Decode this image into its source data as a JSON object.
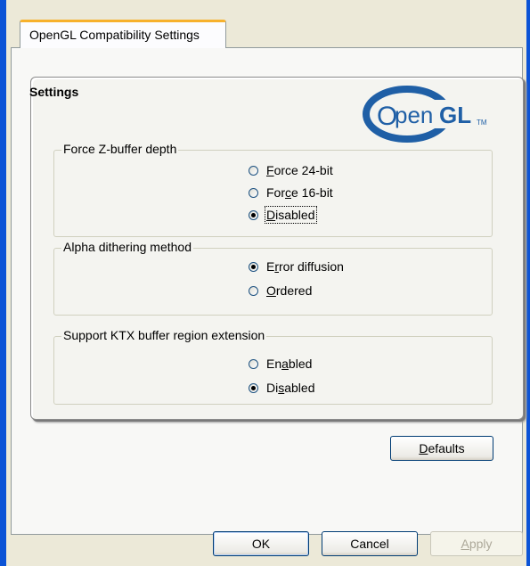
{
  "tab": {
    "label": "OpenGL Compatibility Settings"
  },
  "panel": {
    "title": "Settings",
    "logo_text": "OpenGL",
    "logo_tm": "™"
  },
  "groups": [
    {
      "legend": "Force Z-buffer depth",
      "options": [
        {
          "pre": "",
          "accel": "F",
          "post": "orce 24-bit",
          "checked": false
        },
        {
          "pre": "For",
          "accel": "c",
          "post": "e 16-bit",
          "checked": false
        },
        {
          "pre": "",
          "accel": "D",
          "post": "isabled",
          "checked": true
        }
      ]
    },
    {
      "legend": "Alpha dithering method",
      "options": [
        {
          "pre": "E",
          "accel": "r",
          "post": "ror diffusion",
          "checked": true
        },
        {
          "pre": "",
          "accel": "O",
          "post": "rdered",
          "checked": false
        }
      ]
    },
    {
      "legend": "Support KTX buffer region extension",
      "options": [
        {
          "pre": "En",
          "accel": "a",
          "post": "bled",
          "checked": false
        },
        {
          "pre": "Di",
          "accel": "s",
          "post": "abled",
          "checked": true
        }
      ]
    }
  ],
  "buttons": {
    "defaults": {
      "pre": "",
      "accel": "D",
      "post": "efaults"
    },
    "ok": "OK",
    "cancel": "Cancel",
    "apply": {
      "pre": "",
      "accel": "A",
      "post": "pply"
    }
  },
  "colors": {
    "title_bar_blue": "#0b53d6",
    "tab_highlight": "#f7b12c",
    "logo_blue": "#1f5fa6"
  }
}
